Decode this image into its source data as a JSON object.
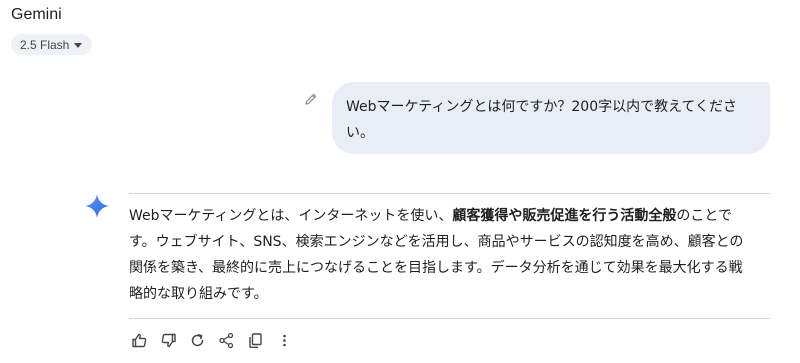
{
  "header": {
    "app_title": "Gemini",
    "model_selector": "2.5 Flash"
  },
  "user_message": {
    "line1": "Webマーケティングとは何ですか？200字以内で教えてくださ",
    "line2": "い。"
  },
  "response": {
    "line1_pre": "Webマーケティングとは、インターネットを使い、",
    "line1_bold": "顧客獲得や販売促進を行う活動全般",
    "line1_post": "のことで",
    "line2": "す。ウェブサイト、SNS、検索エンジンなどを活用し、商品やサービスの認知度を高め、顧客との",
    "line3": "関係を築き、最終的に売上につなげることを目指します。データ分析を通じて効果を最大化する戦",
    "line4": "略的な取り組みです。"
  },
  "icons": {
    "edit": "pencil-icon",
    "sparkle": "gemini-sparkle-icon",
    "actions": [
      "thumbs-up-icon",
      "thumbs-down-icon",
      "regenerate-icon",
      "share-icon",
      "copy-icon",
      "more-vert-icon"
    ]
  },
  "colors": {
    "user_bubble": "#e9eef6",
    "model_chip": "#eef1f6",
    "sparkle": "#4285f4",
    "icon_gray": "#444746"
  }
}
